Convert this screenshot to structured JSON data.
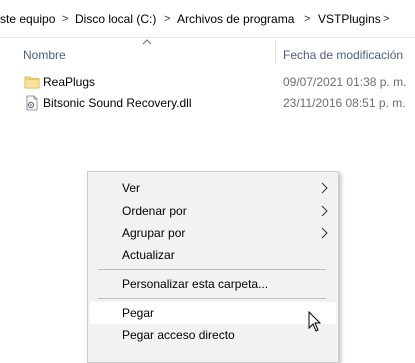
{
  "breadcrumb": {
    "items": [
      {
        "label": "ste equipo"
      },
      {
        "label": "Disco local (C:)"
      },
      {
        "label": "Archivos de programa"
      },
      {
        "label": "VSTPlugins"
      }
    ],
    "separator": ">"
  },
  "columns": {
    "name": "Nombre",
    "modified": "Fecha de modificación"
  },
  "files": [
    {
      "name": "ReaPlugs",
      "modified": "09/07/2021 01:38 p. m.",
      "icon": "folder-icon"
    },
    {
      "name": "Bitsonic Sound Recovery.dll",
      "modified": "23/11/2016 08:51 p. m.",
      "icon": "dll-file-icon"
    }
  ],
  "context_menu": {
    "items": [
      {
        "label": "Ver",
        "submenu": true
      },
      {
        "label": "Ordenar por",
        "submenu": true
      },
      {
        "label": "Agrupar por",
        "submenu": true
      },
      {
        "label": "Actualizar",
        "submenu": false
      },
      {
        "label": "Personalizar esta carpeta...",
        "submenu": false
      },
      {
        "label": "Pegar",
        "submenu": false,
        "hovered": true
      },
      {
        "label": "Pegar acceso directo",
        "submenu": false
      }
    ]
  },
  "colors": {
    "folder": "#f8d775",
    "column_header_text": "#4c607a",
    "date_text": "#6d6d6d",
    "menu_background": "#f2f2f2",
    "menu_hover": "#ffffff"
  }
}
